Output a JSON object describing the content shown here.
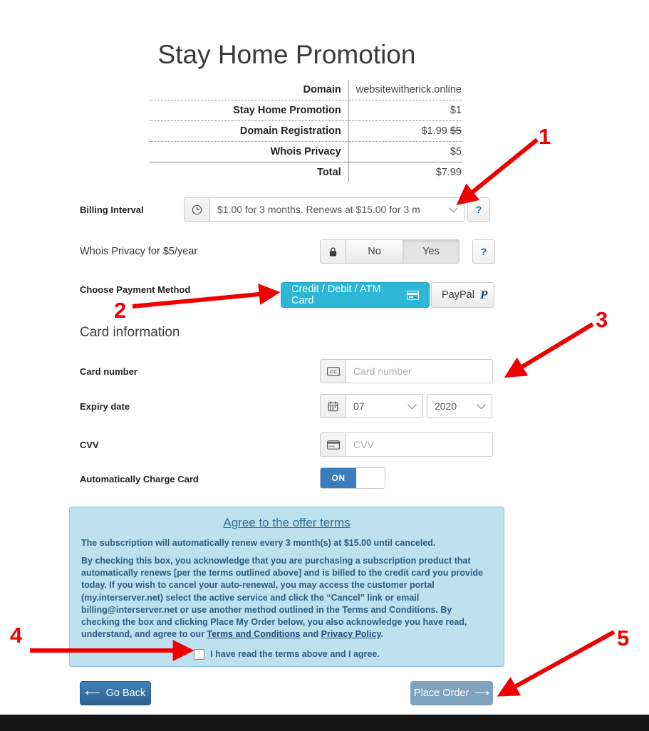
{
  "page_title": "Stay Home Promotion",
  "summary": {
    "rows": [
      {
        "label": "Domain",
        "value": "websitewitherick.online",
        "strike": ""
      },
      {
        "label": "Stay Home Promotion",
        "value": "$1",
        "strike": ""
      },
      {
        "label": "Domain Registration",
        "value": "$1.99",
        "strike": "$5"
      },
      {
        "label": "Whois Privacy",
        "value": "$5",
        "strike": ""
      },
      {
        "label": "Total",
        "value": "$7.99",
        "strike": ""
      }
    ]
  },
  "billing_interval": {
    "label": "Billing Interval",
    "icon": "clock-icon",
    "selected": "$1.00 for 3 months. Renews at $15.00 for 3 m",
    "help": "?"
  },
  "whois_privacy": {
    "label": "Whois Privacy for $5/year",
    "icon": "lock-icon",
    "option_no": "No",
    "option_yes": "Yes",
    "selected": "Yes",
    "help": "?"
  },
  "payment_method": {
    "label": "Choose Payment Method",
    "card_button": "Credit / Debit / ATM Card",
    "paypal_button": "PayPal",
    "paypal_mark": "P",
    "selected": "Credit / Debit / ATM Card",
    "accent_color": "#2eb6d6"
  },
  "card_information": {
    "heading": "Card information",
    "card_number": {
      "label": "Card number",
      "placeholder": "Card number",
      "value": "",
      "icon": "credit-card-icon"
    },
    "expiry": {
      "label": "Expiry date",
      "icon": "calendar-icon",
      "month": "07",
      "year": "2020"
    },
    "cvv": {
      "label": "CVV",
      "placeholder": "CVV",
      "value": "",
      "icon": "card-back-icon"
    },
    "auto_charge": {
      "label": "Automatically Charge Card",
      "state": "ON"
    }
  },
  "terms": {
    "title": "Agree to the offer terms",
    "renew_line": "The subscription will automatically renew every 3 month(s) at $15.00 until canceled.",
    "body_1": "By checking this box, you acknowledge that you are purchasing a subscription product that automatically renews [per the terms outlined above] and is billed to the credit card you provide today. If you wish to cancel your auto-renewal, you may access the customer portal (my.interserver.net) select the active service and click the “Cancel” link or email billing@interserver.net or use another method outlined in the Terms and Conditions. By checking the box and clicking Place My Order below, you also acknowledge you have read, understand, and agree to our ",
    "link_terms": "Terms and Conditions",
    "body_2": " and ",
    "link_privacy": "Privacy Policy",
    "body_3": ".",
    "checkbox_label": "I have read the terms above and I agree.",
    "checked": false
  },
  "footer": {
    "go_back": "Go Back",
    "place_order": "Place Order"
  },
  "annotations": {
    "color": "#ee0000",
    "items": [
      {
        "number": "1",
        "target": "billing-interval-select"
      },
      {
        "number": "2",
        "target": "payment-method-card-button"
      },
      {
        "number": "3",
        "target": "card-number-input"
      },
      {
        "number": "4",
        "target": "terms-checkbox"
      },
      {
        "number": "5",
        "target": "place-order-button"
      }
    ]
  }
}
